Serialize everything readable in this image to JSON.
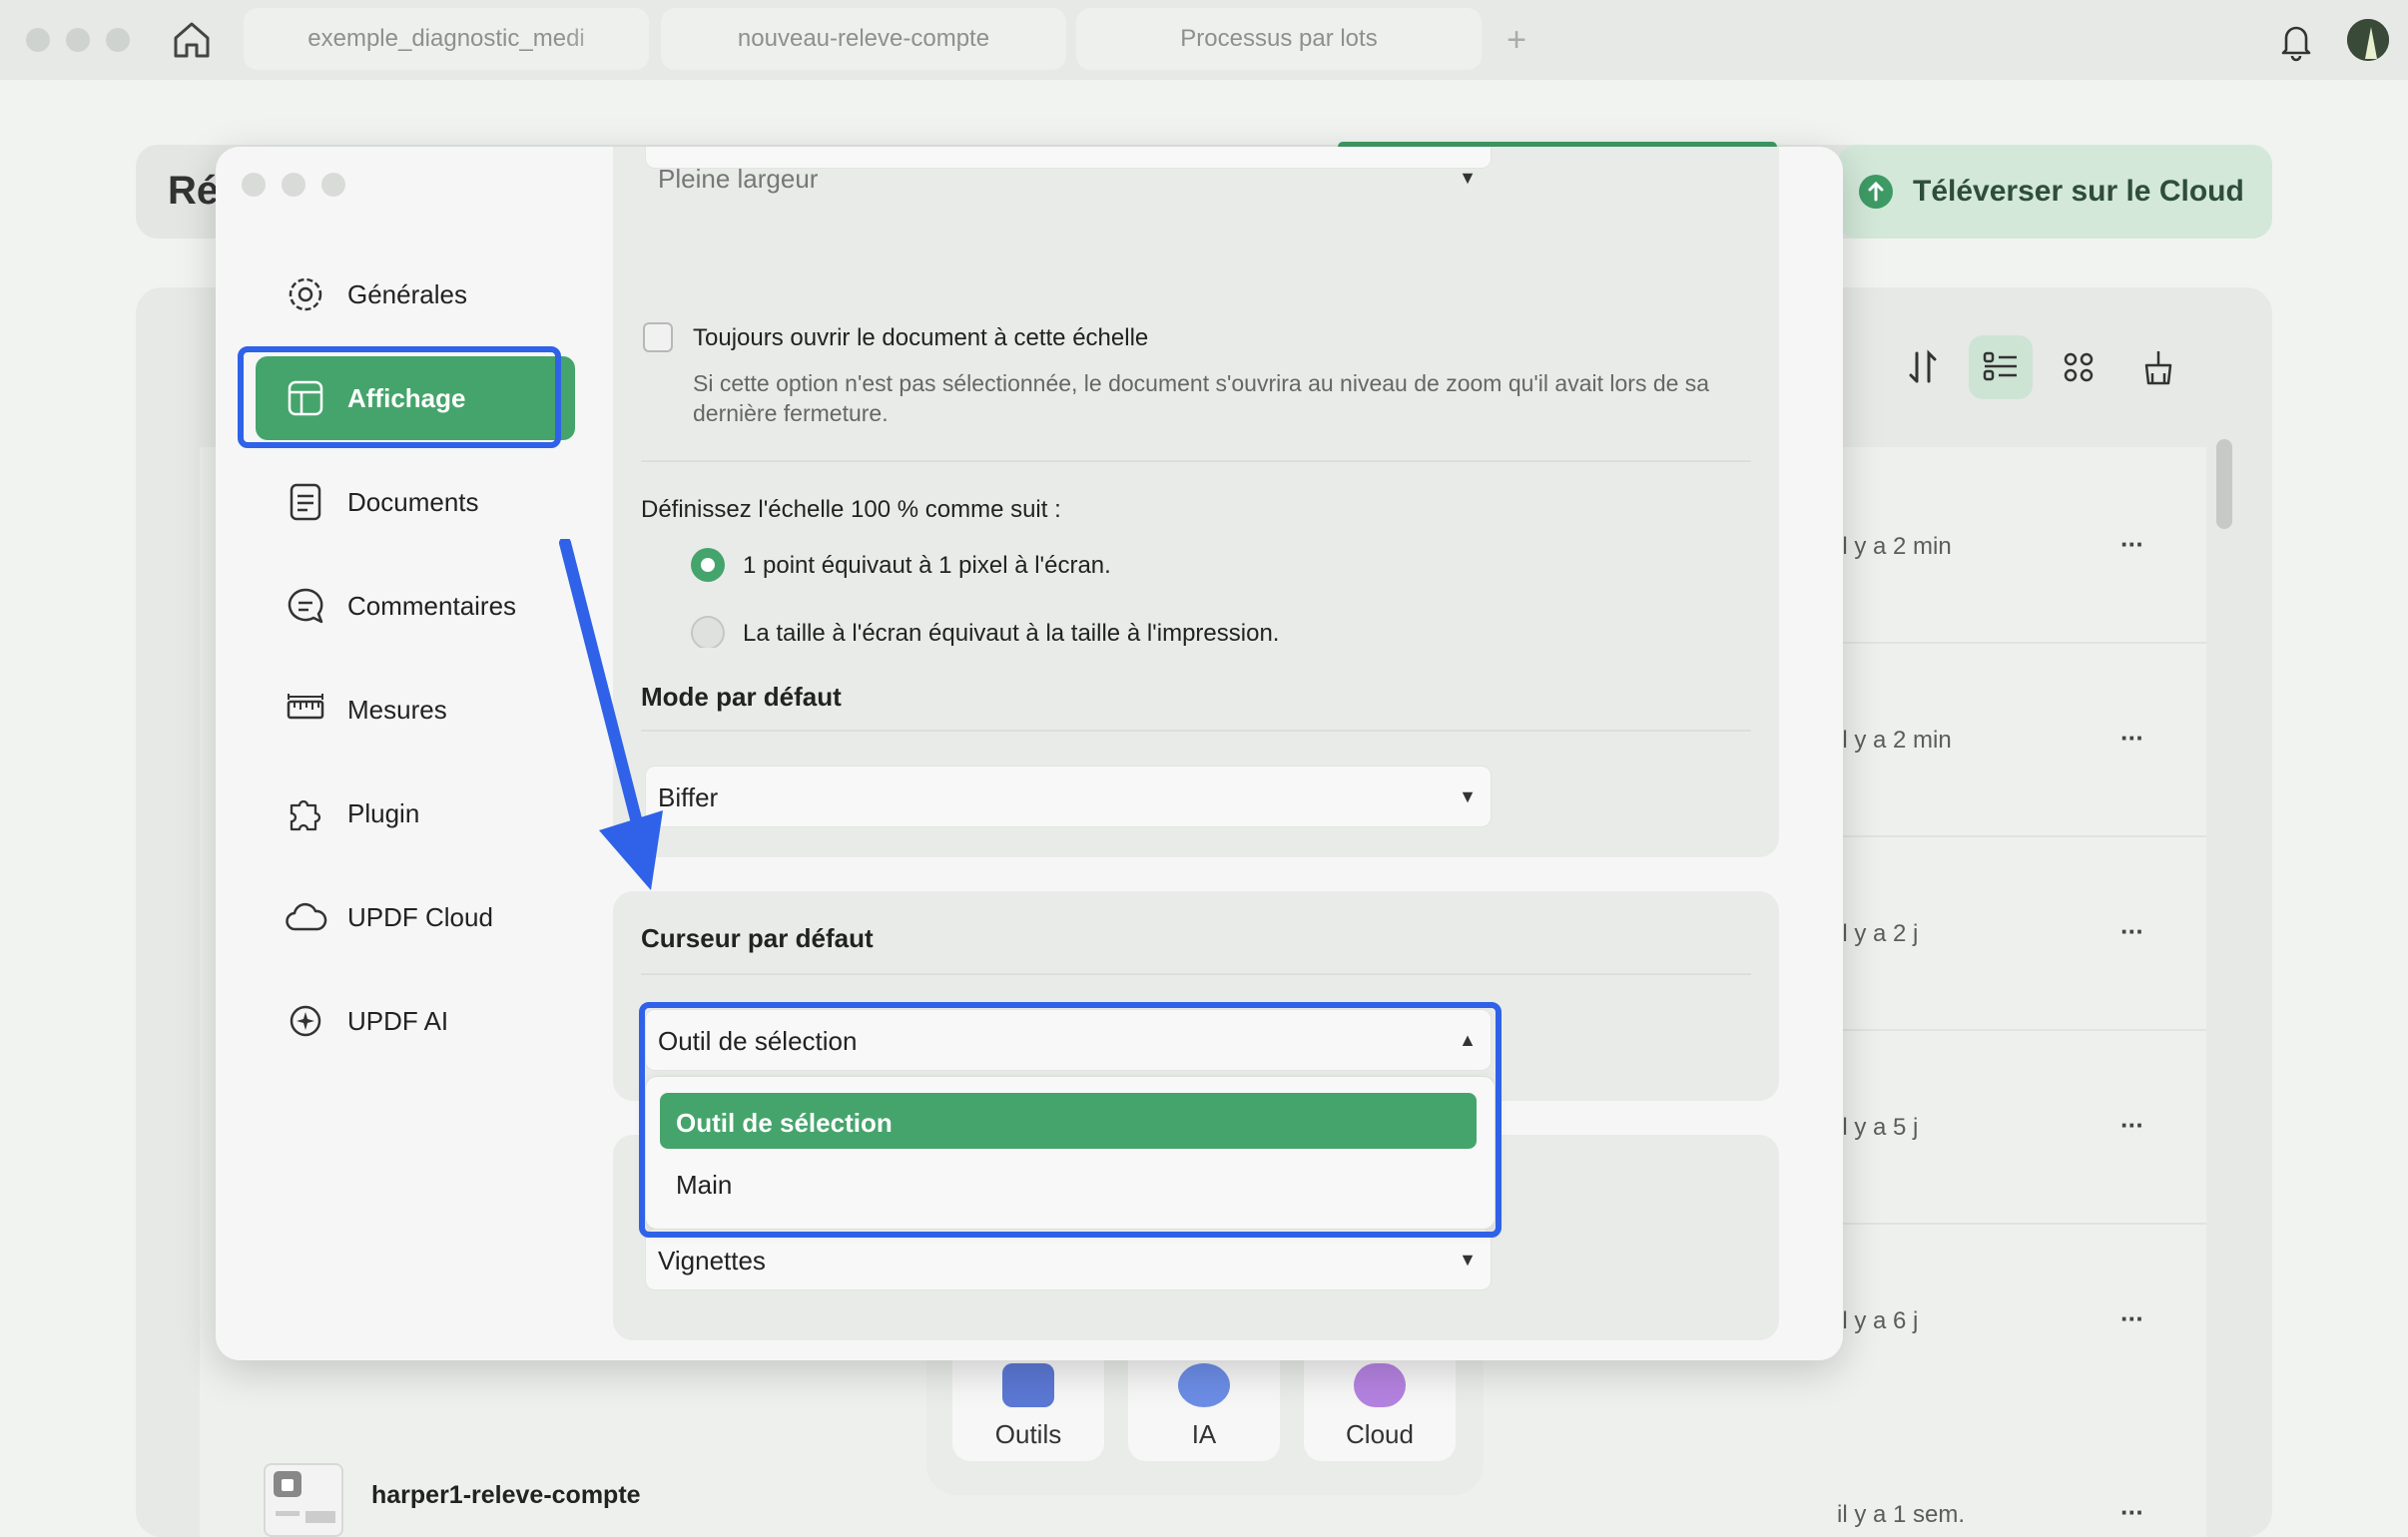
{
  "window": {
    "tabs": [
      {
        "label": "exemple_diagnostic_medi"
      },
      {
        "label": "nouveau-releve-compte"
      },
      {
        "label": "Processus par lots"
      }
    ],
    "new_tab_glyph": "+"
  },
  "background": {
    "header_title": "Ré",
    "upload_button": "Téléverser sur le Cloud",
    "rows": [
      {
        "time": "il y a 2 min"
      },
      {
        "time": "il y a 2 min"
      },
      {
        "time": "il y a 2 j"
      },
      {
        "time": "il y a 5 j"
      },
      {
        "time": "il y a 6 j"
      },
      {
        "time": "il y a 1 sem."
      }
    ],
    "more_glyph": "···",
    "dock": [
      {
        "label": "Outils",
        "icon": "toolbox-icon"
      },
      {
        "label": "IA",
        "icon": "ai-icon"
      },
      {
        "label": "Cloud",
        "icon": "cloud-icon"
      }
    ],
    "file_name": "harper1-releve-compte",
    "colors": {
      "accent": "#45a46b",
      "highlight": "#2f62e8"
    }
  },
  "preferences": {
    "sidebar": [
      {
        "label": "Générales",
        "icon": "gear-icon"
      },
      {
        "label": "Affichage",
        "icon": "layout-icon",
        "active": true
      },
      {
        "label": "Documents",
        "icon": "document-icon"
      },
      {
        "label": "Commentaires",
        "icon": "comment-icon"
      },
      {
        "label": "Mesures",
        "icon": "ruler-icon"
      },
      {
        "label": "Plugin",
        "icon": "puzzle-icon"
      },
      {
        "label": "UPDF Cloud",
        "icon": "cloud-icon"
      },
      {
        "label": "UPDF AI",
        "icon": "ai-sparkle-icon"
      }
    ],
    "zoom": {
      "select_value": "Pleine largeur",
      "always_open_label": "Toujours ouvrir le document à cette échelle",
      "always_open_checked": false,
      "hint": "Si cette option n'est pas sélectionnée, le document s'ouvrira au niveau de zoom qu'il avait lors de sa dernière fermeture.",
      "scale_label": "Définissez l'échelle 100 % comme suit :",
      "options": [
        {
          "label": "1 point équivaut à 1 pixel à l'écran.",
          "selected": true
        },
        {
          "label": "La taille à l'écran équivaut à la taille à l'impression.",
          "selected": false
        }
      ]
    },
    "default_mode": {
      "title": "Mode par défaut",
      "value": "Biffer"
    },
    "default_cursor": {
      "title": "Curseur par défaut",
      "value": "Outil de sélection",
      "open": true,
      "options": [
        {
          "label": "Outil de sélection",
          "selected": true
        },
        {
          "label": "Main",
          "selected": false
        }
      ]
    },
    "next_section": {
      "value": "Vignettes"
    }
  }
}
